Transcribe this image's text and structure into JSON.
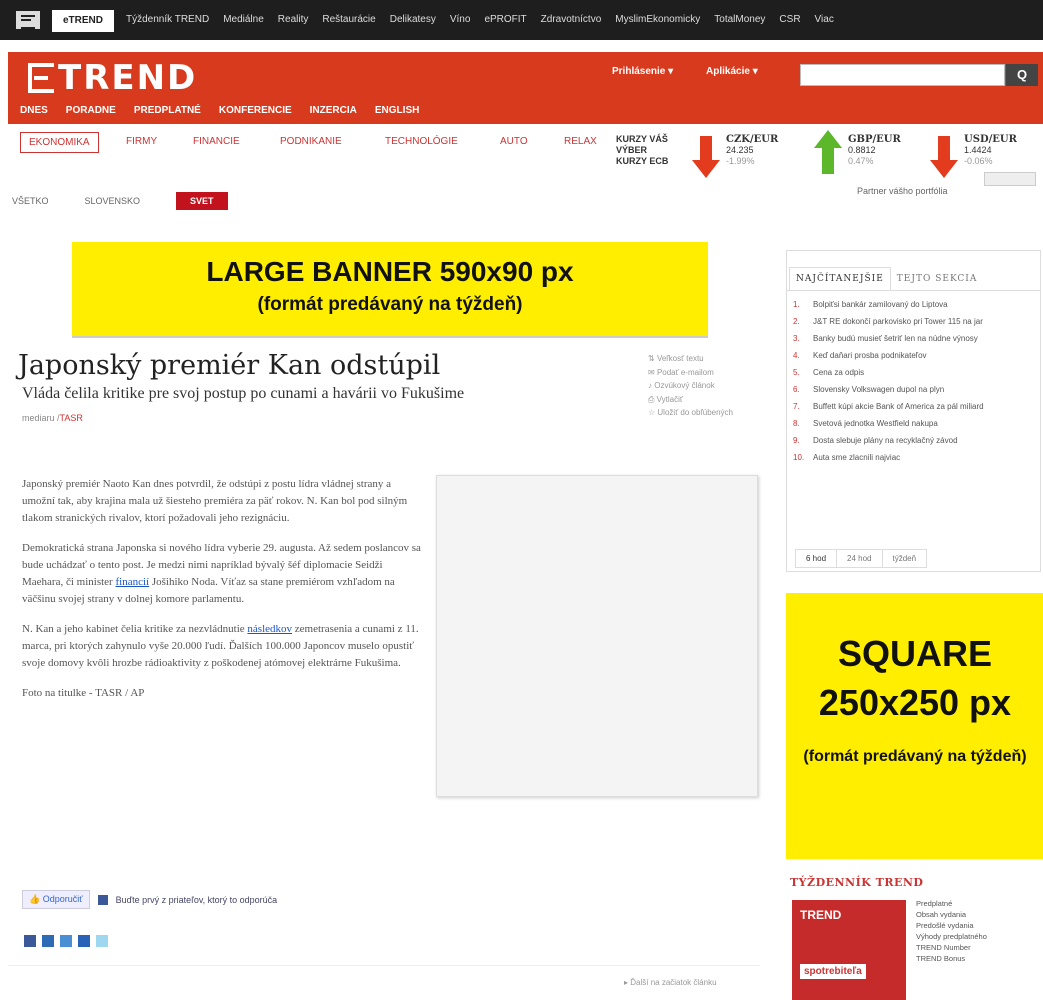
{
  "topbar": {
    "active_tab": "eTREND",
    "links": [
      "Týždenník TREND",
      "Mediálne",
      "Reality",
      "Reštaurácie",
      "Delikatesy",
      "Víno",
      "ePROFIT",
      "Zdravotníctvo",
      "MyslimEkonomicky",
      "TotalMoney",
      "CSR",
      "Viac"
    ]
  },
  "header": {
    "brand": "TREND",
    "link1": "Prihlásenie",
    "link2": "Aplikácie",
    "search_placeholder": "",
    "search_button": "Q",
    "main_nav": [
      "DNES",
      "PORADNE",
      "PREDPLATNÉ",
      "KONFERENCIE",
      "INZERCIA",
      "ENGLISH"
    ]
  },
  "subnav": {
    "items": [
      "EKONOMIKA",
      "FIRMY",
      "FINANCIE",
      "PODNIKANIE",
      "TECHNOLÓGIE",
      "AUTO",
      "RELAX"
    ]
  },
  "rates": {
    "label": "KURZY VÁŠ VÝBER KURZY ECB",
    "items": [
      {
        "name": "CZK/EUR",
        "value": "24.235",
        "change": "-1.99%",
        "direction": "down",
        "color": "#e23b1e"
      },
      {
        "name": "GBP/EUR",
        "value": "0.8812",
        "change": "0.47%",
        "direction": "up",
        "color": "#5cb82a"
      },
      {
        "name": "USD/EUR",
        "value": "1.4424",
        "change": "-0.06%",
        "direction": "down",
        "color": "#e23b1e"
      }
    ],
    "partner": "Partner vášho portfólia"
  },
  "breadcrumb": {
    "a": "VŠETKO",
    "b": "SLOVENSKO",
    "c": "SVET"
  },
  "banner": {
    "line1": "LARGE BANNER 590x90 px",
    "line2": "(formát predávaný na týždeň)"
  },
  "article": {
    "title": "Japonský premiér Kan odstúpil",
    "subtitle": "Vláda čelila kritike pre svoj postup po cunami a havárii vo Fukušime",
    "author": "mediaru /",
    "agency": "TASR",
    "tools": [
      "Veľkosť textu",
      "Podať e-mailom",
      "Ozvúkový článok",
      "Vytlačiť",
      "Uložiť do obľúbených"
    ],
    "p1": "Japonský premiér Naoto Kan dnes potvrdil, že odstúpi z postu lídra vládnej strany a umožní tak, aby krajina mala už šiesteho premiéra za päť rokov. N. Kan bol pod silným tlakom stranických rivalov, ktorí požadovali jeho rezignáciu.",
    "p2a": "Demokratická strana Japonska si nového lídra vyberie 29. augusta. Až sedem poslancov sa bude uchádzať o tento post. Je medzi nimi napríklad bývalý šéf diplomacie Seidži Maehara, či minister ",
    "p2link": "financií",
    "p2b": " Jošihiko Noda. Víťaz sa stane premiérom vzhľadom na väčšinu svojej strany v dolnej komore parlamentu.",
    "p3a": "N. Kan a jeho kabinet čelia kritike za nezvládnutie ",
    "p3link": "následkov",
    "p3b": " zemetrasenia a cunami z 11. marca, pri ktorých zahynulo vyše 20.000 ľudí. Ďalších 100.000 Japoncov muselo opustiť svoje domovy kvôli hrozbe rádioaktivity z poškodenej atómovej elektrárne Fukušima.",
    "photo_credit": "Foto na titulke - TASR / AP",
    "like": "Odporučiť",
    "like_text": "Buďte prvý z priateľov, ktorý to odporúča",
    "next": "Ďalší na začiatok článku"
  },
  "sidebar": {
    "tab_active": "NAJČÍTANEJŠIE",
    "tab_other": "TEJTO SEKCIA",
    "items": [
      "Bolpiťsi bankár zamilovaný do Liptova",
      "J&T RE dokončí parkovisko pri Tower 115 na jar",
      "Banky budú musieť šetriť len na núdne výnosy",
      "Keď daňari prosba podnikateľov",
      "Cena za odpis",
      "Slovensky Volkswagen dupol na plyn",
      "Buffett kúpi akcie Bank of America za pál miliard",
      "Svetová jednotka Westfield nakupa",
      "Dosta slebuje plány na recyklačný závod",
      "Auta sme zlacnili najviac"
    ],
    "foot": [
      "6 hod",
      "24 hod",
      "týždeň"
    ]
  },
  "square": {
    "l1": "SQUARE",
    "l2": "250x250 px",
    "l3": "(formát predávaný na týždeň)"
  },
  "weekly": {
    "title": "TÝŽDENNÍK TREND",
    "cover_title": "TREND",
    "cover_sub": "spotrebiteľa",
    "items": [
      "Predplatné",
      "Obsah vydania",
      "Predošlé vydania",
      "Výhody predplatného",
      "TREND Number",
      "TREND Bonus"
    ]
  }
}
